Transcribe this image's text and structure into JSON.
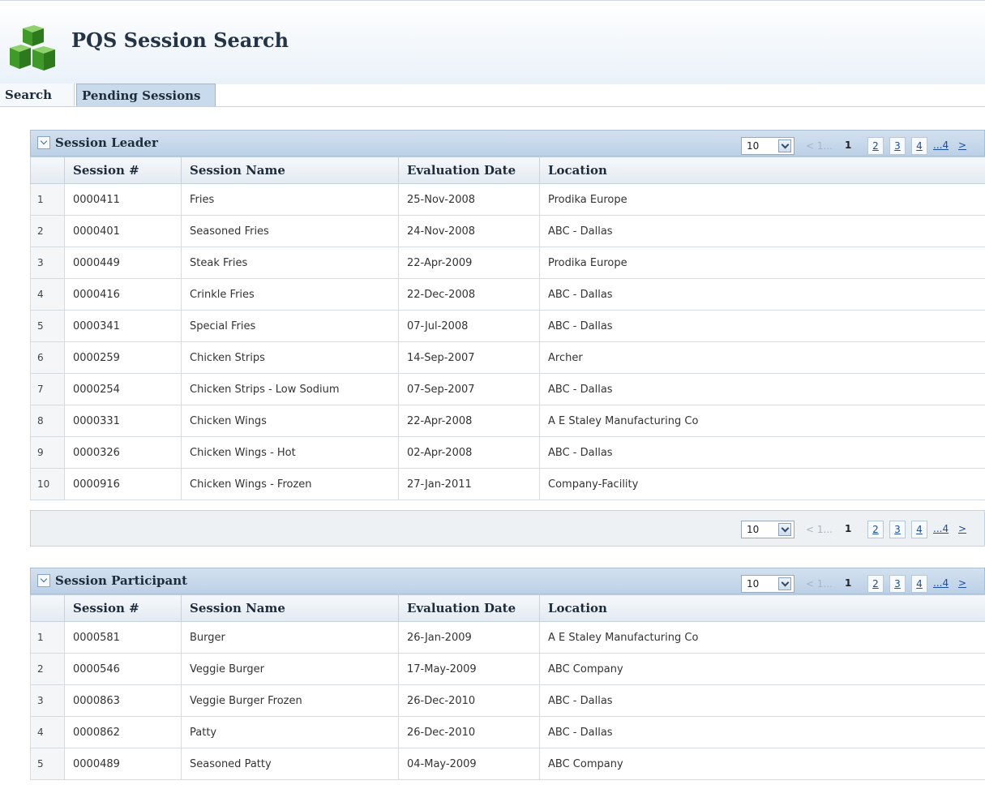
{
  "app": {
    "title": "PQS Session Search"
  },
  "tabs": [
    {
      "label": "Search"
    },
    {
      "label": "Pending Sessions"
    }
  ],
  "pager": {
    "page_size": "10",
    "prev_label": "< 1...",
    "current": "1",
    "pages": [
      "2",
      "3",
      "4"
    ],
    "more": "...4",
    "next": ">"
  },
  "columns": [
    "Session #",
    "Session Name",
    "Evaluation Date",
    "Location"
  ],
  "session_leader": {
    "title": "Session Leader",
    "rows": [
      {
        "n": "1",
        "id": "0000411",
        "name": "Fries",
        "date": "25-Nov-2008",
        "location": "Prodika Europe"
      },
      {
        "n": "2",
        "id": "0000401",
        "name": "Seasoned Fries",
        "date": "24-Nov-2008",
        "location": "ABC - Dallas"
      },
      {
        "n": "3",
        "id": "0000449",
        "name": "Steak Fries",
        "date": "22-Apr-2009",
        "location": "Prodika Europe"
      },
      {
        "n": "4",
        "id": "0000416",
        "name": "Crinkle Fries",
        "date": "22-Dec-2008",
        "location": "ABC - Dallas"
      },
      {
        "n": "5",
        "id": "0000341",
        "name": "Special Fries",
        "date": "07-Jul-2008",
        "location": "ABC - Dallas"
      },
      {
        "n": "6",
        "id": "0000259",
        "name": "Chicken Strips",
        "date": "14-Sep-2007",
        "location": "Archer"
      },
      {
        "n": "7",
        "id": "0000254",
        "name": "Chicken Strips - Low Sodium",
        "date": "07-Sep-2007",
        "location": "ABC - Dallas"
      },
      {
        "n": "8",
        "id": "0000331",
        "name": "Chicken Wings",
        "date": "22-Apr-2008",
        "location": "A E Staley Manufacturing Co"
      },
      {
        "n": "9",
        "id": "0000326",
        "name": "Chicken Wings - Hot",
        "date": "02-Apr-2008",
        "location": "ABC - Dallas"
      },
      {
        "n": "10",
        "id": "0000916",
        "name": "Chicken Wings - Frozen",
        "date": "27-Jan-2011",
        "location": "Company-Facility"
      }
    ]
  },
  "session_participant": {
    "title": "Session Participant",
    "rows": [
      {
        "n": "1",
        "id": "0000581",
        "name": "Burger",
        "date": "26-Jan-2009",
        "location": "A E Staley Manufacturing Co"
      },
      {
        "n": "2",
        "id": "0000546",
        "name": "Veggie Burger",
        "date": "17-May-2009",
        "location": "ABC Company"
      },
      {
        "n": "3",
        "id": "0000863",
        "name": "Veggie Burger Frozen",
        "date": "26-Dec-2010",
        "location": "ABC - Dallas"
      },
      {
        "n": "4",
        "id": "0000862",
        "name": "Patty",
        "date": "26-Dec-2010",
        "location": "ABC - Dallas"
      },
      {
        "n": "5",
        "id": "0000489",
        "name": "Seasoned Patty",
        "date": "04-May-2009",
        "location": "ABC Company"
      }
    ]
  }
}
